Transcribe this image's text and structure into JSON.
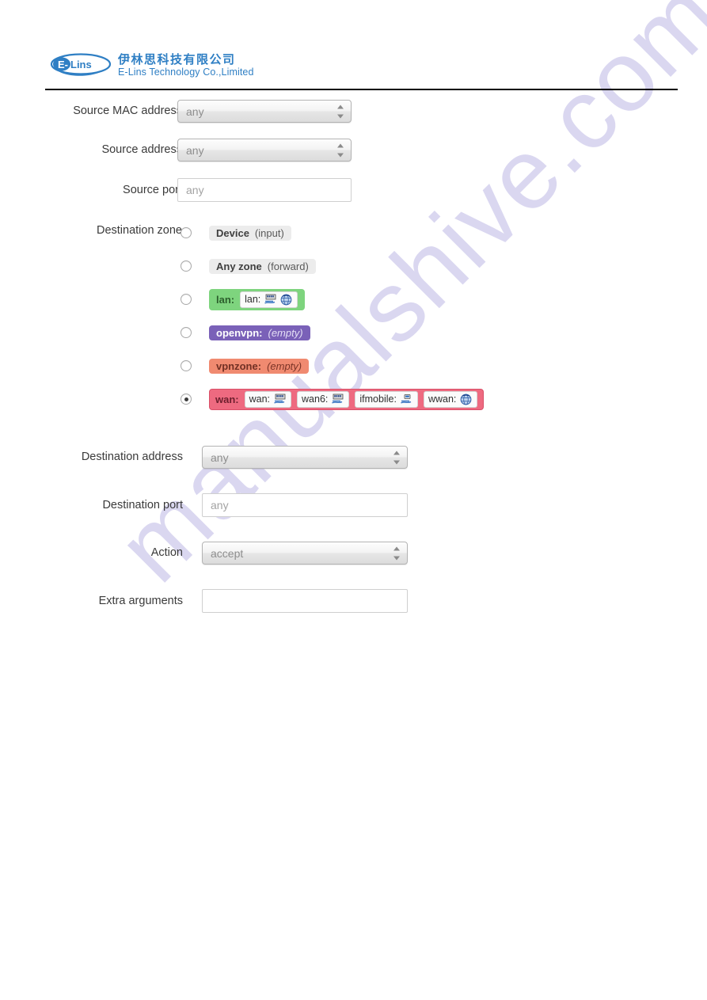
{
  "brand": {
    "logo_wordmark": "E-Lins",
    "company_cn": "伊林思科技有限公司",
    "company_en": "E-Lins Technology Co.,Limited",
    "logo_color": "#2f7fc4"
  },
  "watermark": {
    "text": "manualshive.com",
    "color": "#b9b4e4"
  },
  "form": {
    "fields": [
      {
        "label": "Source MAC address",
        "control": "select",
        "value": "any"
      },
      {
        "label": "Source address",
        "control": "select",
        "value": "any"
      },
      {
        "label": "Source port",
        "control": "text",
        "value": "",
        "placeholder": "any"
      }
    ],
    "zone_group": {
      "label": "Destination zone",
      "selected_index": 5,
      "options": [
        {
          "name": "Device",
          "sub": "(input)",
          "sub_italic": false,
          "style": "plain",
          "interfaces": []
        },
        {
          "name": "Any zone",
          "sub": "(forward)",
          "sub_italic": false,
          "style": "plain",
          "interfaces": []
        },
        {
          "name": "lan:",
          "sub": "",
          "sub_italic": false,
          "style": "lan",
          "interfaces": [
            {
              "label": "lan:",
              "icons": [
                "ethernet-icon",
                "wireless-icon"
              ]
            }
          ]
        },
        {
          "name": "openvpn:",
          "sub": "(empty)",
          "sub_italic": true,
          "style": "openvpn",
          "interfaces": []
        },
        {
          "name": "vpnzone:",
          "sub": "(empty)",
          "sub_italic": true,
          "style": "vpnzone",
          "interfaces": []
        },
        {
          "name": "wan:",
          "sub": "",
          "sub_italic": false,
          "style": "wan",
          "interfaces": [
            {
              "label": "wan:",
              "icons": [
                "ethernet-icon"
              ]
            },
            {
              "label": "wan6:",
              "icons": [
                "ethernet-icon"
              ]
            },
            {
              "label": "ifmobile:",
              "icons": [
                "modem-icon"
              ]
            },
            {
              "label": "wwan:",
              "icons": [
                "wireless-icon"
              ]
            }
          ]
        }
      ]
    },
    "fields_lower": [
      {
        "label": "Destination address",
        "control": "select",
        "value": "any"
      },
      {
        "label": "Destination port",
        "control": "text",
        "value": "",
        "placeholder": "any"
      },
      {
        "label": "Action",
        "control": "select",
        "value": "accept"
      },
      {
        "label": "Extra arguments",
        "control": "text",
        "value": "",
        "placeholder": ""
      }
    ]
  },
  "colors": {
    "zone_lan": "#7ed47e",
    "zone_openvpn": "#7a61b8",
    "zone_vpnzone": "#f08a70",
    "zone_wan": "#ee6a80",
    "zone_plain": "#ececec"
  }
}
